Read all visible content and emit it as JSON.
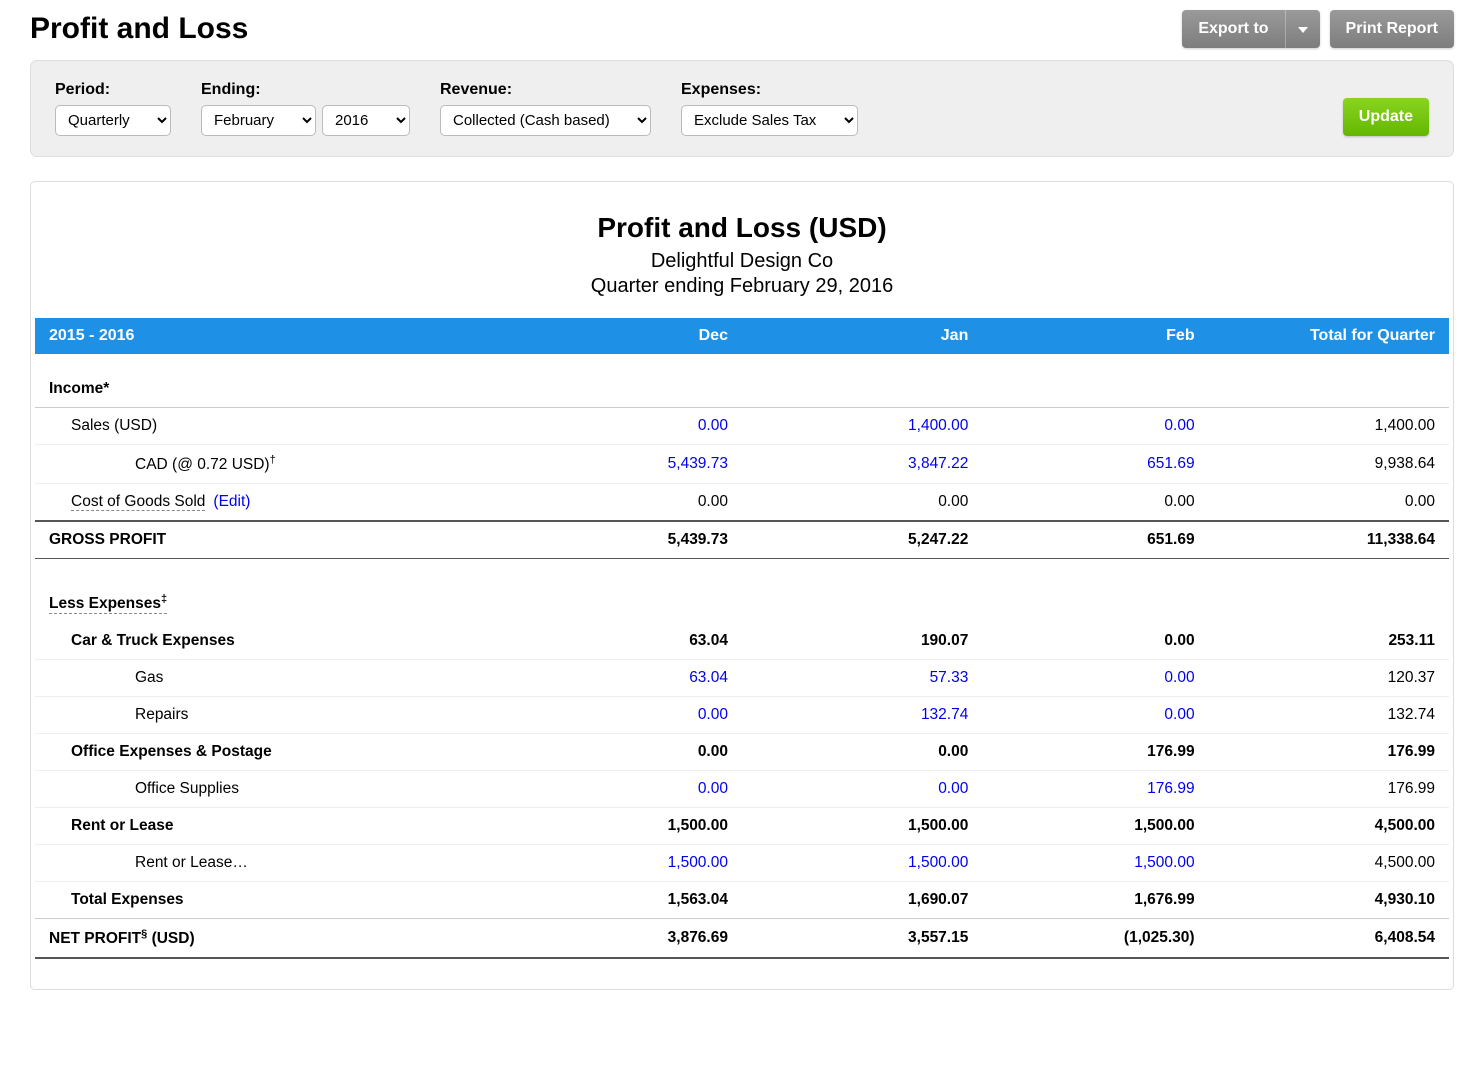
{
  "page": {
    "title": "Profit and Loss"
  },
  "actions": {
    "export": "Export to",
    "print": "Print Report",
    "update": "Update"
  },
  "filters": {
    "period": {
      "label": "Period:",
      "value": "Quarterly"
    },
    "ending": {
      "label": "Ending:",
      "month": "February",
      "year": "2016"
    },
    "revenue": {
      "label": "Revenue:",
      "value": "Collected (Cash based)"
    },
    "expenses": {
      "label": "Expenses:",
      "value": "Exclude Sales Tax"
    }
  },
  "report": {
    "title": "Profit and Loss (USD)",
    "company": "Delightful Design Co",
    "period_desc": "Quarter ending February 29, 2016",
    "columns": {
      "range": "2015 - 2016",
      "m1": "Dec",
      "m2": "Jan",
      "m3": "Feb",
      "total": "Total for Quarter"
    },
    "income_header": "Income*",
    "sales_usd": {
      "label": "Sales (USD)",
      "m1": "0.00",
      "m2": "1,400.00",
      "m3": "0.00",
      "total": "1,400.00"
    },
    "sales_cad": {
      "label": "CAD (@ 0.72 USD)",
      "dagger": "†",
      "m1": "5,439.73",
      "m2": "3,847.22",
      "m3": "651.69",
      "total": "9,938.64"
    },
    "cogs": {
      "label": "Cost of Goods Sold",
      "edit": "(Edit)",
      "m1": "0.00",
      "m2": "0.00",
      "m3": "0.00",
      "total": "0.00"
    },
    "gross_profit": {
      "label": "GROSS PROFIT",
      "m1": "5,439.73",
      "m2": "5,247.22",
      "m3": "651.69",
      "total": "11,338.64"
    },
    "less_exp_header": "Less Expenses",
    "less_exp_dagger": "‡",
    "car_truck": {
      "label": "Car & Truck Expenses",
      "m1": "63.04",
      "m2": "190.07",
      "m3": "0.00",
      "total": "253.11"
    },
    "gas": {
      "label": "Gas",
      "m1": "63.04",
      "m2": "57.33",
      "m3": "0.00",
      "total": "120.37"
    },
    "repairs": {
      "label": "Repairs",
      "m1": "0.00",
      "m2": "132.74",
      "m3": "0.00",
      "total": "132.74"
    },
    "office": {
      "label": "Office Expenses & Postage",
      "m1": "0.00",
      "m2": "0.00",
      "m3": "176.99",
      "total": "176.99"
    },
    "office_supplies": {
      "label": "Office Supplies",
      "m1": "0.00",
      "m2": "0.00",
      "m3": "176.99",
      "total": "176.99"
    },
    "rent": {
      "label": "Rent or Lease",
      "m1": "1,500.00",
      "m2": "1,500.00",
      "m3": "1,500.00",
      "total": "4,500.00"
    },
    "rent_sub": {
      "label": "Rent or Lease…",
      "m1": "1,500.00",
      "m2": "1,500.00",
      "m3": "1,500.00",
      "total": "4,500.00"
    },
    "total_expenses": {
      "label": "Total Expenses",
      "m1": "1,563.04",
      "m2": "1,690.07",
      "m3": "1,676.99",
      "total": "4,930.10"
    },
    "net_profit": {
      "label": "NET PROFIT",
      "dagger": "§",
      "unit": " (USD)",
      "m1": "3,876.69",
      "m2": "3,557.15",
      "m3": "(1,025.30)",
      "total": "6,408.54"
    }
  },
  "chart_data": {
    "type": "table",
    "title": "Profit and Loss (USD) — Quarter ending February 29, 2016",
    "columns": [
      "Dec",
      "Jan",
      "Feb",
      "Total for Quarter"
    ],
    "rows": [
      {
        "label": "Sales (USD)",
        "values": [
          0.0,
          1400.0,
          0.0,
          1400.0
        ]
      },
      {
        "label": "CAD (@ 0.72 USD)",
        "values": [
          5439.73,
          3847.22,
          651.69,
          9938.64
        ]
      },
      {
        "label": "Cost of Goods Sold",
        "values": [
          0.0,
          0.0,
          0.0,
          0.0
        ]
      },
      {
        "label": "GROSS PROFIT",
        "values": [
          5439.73,
          5247.22,
          651.69,
          11338.64
        ]
      },
      {
        "label": "Car & Truck Expenses",
        "values": [
          63.04,
          190.07,
          0.0,
          253.11
        ]
      },
      {
        "label": "Gas",
        "values": [
          63.04,
          57.33,
          0.0,
          120.37
        ]
      },
      {
        "label": "Repairs",
        "values": [
          0.0,
          132.74,
          0.0,
          132.74
        ]
      },
      {
        "label": "Office Expenses & Postage",
        "values": [
          0.0,
          0.0,
          176.99,
          176.99
        ]
      },
      {
        "label": "Office Supplies",
        "values": [
          0.0,
          0.0,
          176.99,
          176.99
        ]
      },
      {
        "label": "Rent or Lease",
        "values": [
          1500.0,
          1500.0,
          1500.0,
          4500.0
        ]
      },
      {
        "label": "Rent or Lease…",
        "values": [
          1500.0,
          1500.0,
          1500.0,
          4500.0
        ]
      },
      {
        "label": "Total Expenses",
        "values": [
          1563.04,
          1690.07,
          1676.99,
          4930.1
        ]
      },
      {
        "label": "NET PROFIT (USD)",
        "values": [
          3876.69,
          3557.15,
          -1025.3,
          6408.54
        ]
      }
    ]
  }
}
